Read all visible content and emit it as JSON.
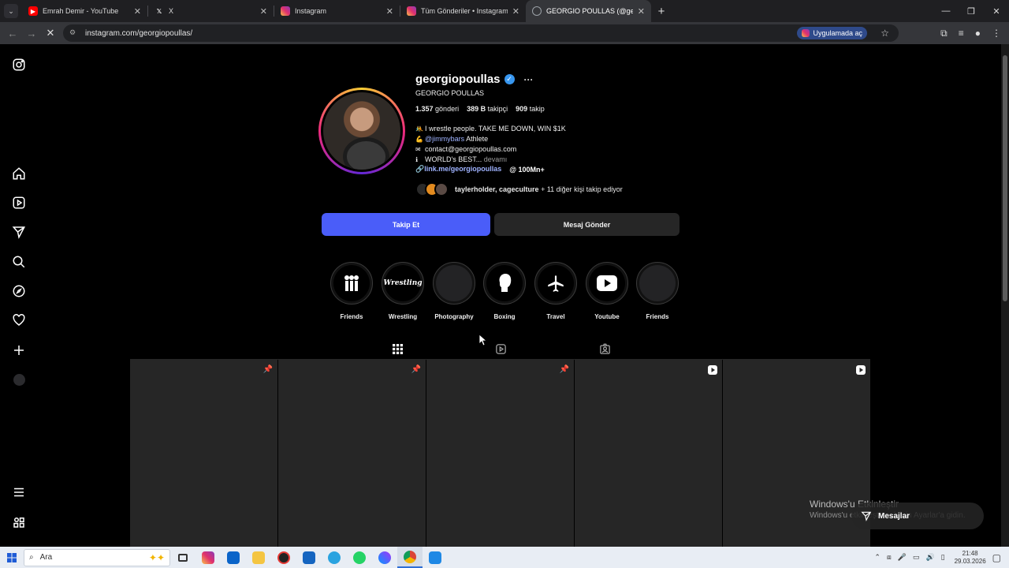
{
  "browser": {
    "tabs": [
      {
        "title": "Emrah Demir - YouTube",
        "favicon": "youtube-icon",
        "color": "#ff0000",
        "active": false
      },
      {
        "title": "X",
        "favicon": "x-icon",
        "color": "#ffffff",
        "active": false
      },
      {
        "title": "Instagram",
        "favicon": "instagram-icon",
        "color": "#e1306c",
        "active": false
      },
      {
        "title": "Tüm Gönderiler • Instagram",
        "favicon": "instagram-icon",
        "color": "#e1306c",
        "active": false
      },
      {
        "title": "GEORGIO POULLAS (@georgio",
        "favicon": "loading-icon",
        "color": "#9aa0a6",
        "active": true
      }
    ],
    "url": "instagram.com/georgiopoullas/",
    "open_in_app": "Uygulamada aç"
  },
  "profile": {
    "username": "georgiopoullas",
    "full_name": "GEORGIO POULLAS",
    "posts_count": "1.357",
    "posts_label": "gönderi",
    "followers_count": "389 B",
    "followers_label": "takipçi",
    "following_count": "909",
    "following_label": "takip",
    "bio": {
      "line1": "I wrestle people. TAKE ME DOWN, WIN $1K",
      "line2_mention": "@jimmybars",
      "line2_rest": "Athlete",
      "line3": "contact@georgiopoullas.com",
      "line4": "WORLD's BEST...",
      "more": "devamı"
    },
    "link": "link.me/georgiopoullas",
    "threads_count": "100Mn+",
    "followed_by_names": "taylerholder, cageculture",
    "followed_by_rest": "+ 11 diğer kişi takip ediyor",
    "follow_button": "Takip Et",
    "message_button": "Mesaj Gönder"
  },
  "highlights": [
    {
      "label": "Friends",
      "icon": "friends-group-icon"
    },
    {
      "label": "Wrestling",
      "icon": "wrestling-logo-icon"
    },
    {
      "label": "Photography",
      "icon": "blank"
    },
    {
      "label": "Boxing",
      "icon": "boxing-glove-icon"
    },
    {
      "label": "Travel",
      "icon": "airplane-icon"
    },
    {
      "label": "Youtube",
      "icon": "youtube-play-icon"
    },
    {
      "label": "Friends",
      "icon": "blank"
    }
  ],
  "posts": [
    {
      "badge": "pinned-icon"
    },
    {
      "badge": "pinned-icon"
    },
    {
      "badge": "pinned-icon"
    },
    {
      "badge": "reel-icon"
    },
    {
      "badge": "reel-icon"
    }
  ],
  "overlay": {
    "watermark_title": "Windows'u Etkinleştir",
    "watermark_sub": "Windows'u etkinleştirmek için Ayarlar'a gidin.",
    "messages": "Mesajlar"
  },
  "taskbar": {
    "search_placeholder": "Ara",
    "time": "21:48",
    "date": "29.03.2026"
  }
}
